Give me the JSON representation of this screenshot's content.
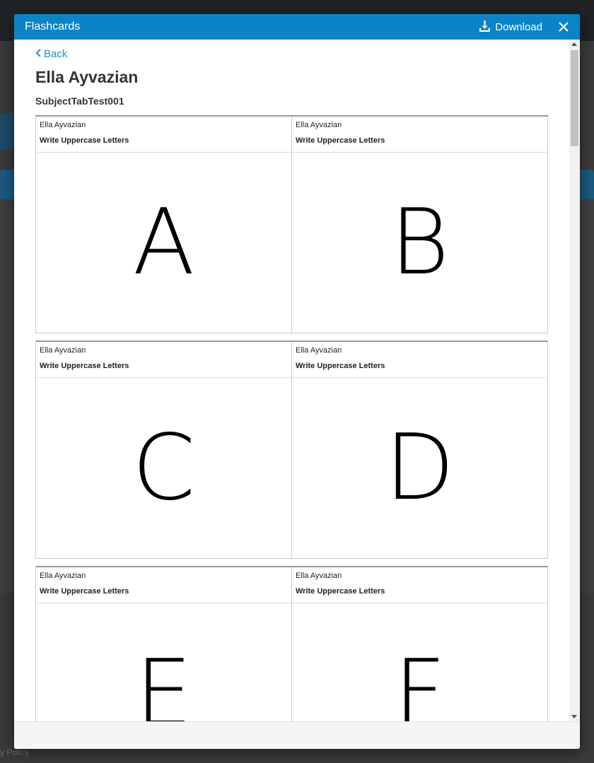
{
  "background": {
    "footer_text": "y Policy"
  },
  "modal": {
    "title": "Flashcards",
    "download_label": "Download",
    "back_label": "Back",
    "student_name": "Ella Ayvazian",
    "subject": "SubjectTabTest001"
  },
  "colors": {
    "header": "#0a84c6",
    "link": "#1b8fd1"
  },
  "cards": [
    {
      "name": "Ella Ayvazian",
      "topic": "Write Uppercase Letters",
      "letter": "A"
    },
    {
      "name": "Ella Ayvazian",
      "topic": "Write Uppercase Letters",
      "letter": "B"
    },
    {
      "name": "Ella Ayvazian",
      "topic": "Write Uppercase Letters",
      "letter": "C"
    },
    {
      "name": "Ella Ayvazian",
      "topic": "Write Uppercase Letters",
      "letter": "D"
    },
    {
      "name": "Ella Ayvazian",
      "topic": "Write Uppercase Letters",
      "letter": "E"
    },
    {
      "name": "Ella Ayvazian",
      "topic": "Write Uppercase Letters",
      "letter": "F"
    }
  ]
}
